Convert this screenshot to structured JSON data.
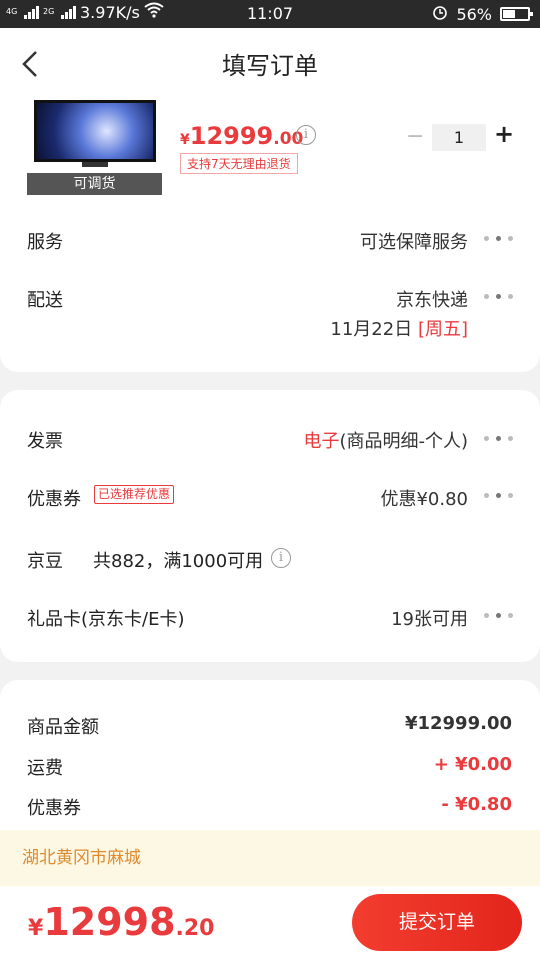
{
  "status_bar": {
    "network": "3.97K/s",
    "time": "11:07",
    "battery": "56%",
    "net_types": [
      "4G",
      "2G"
    ]
  },
  "header": {
    "title": "填写订单"
  },
  "product": {
    "stock_tag": "可调货",
    "price_symbol": "¥",
    "price_int": "12999",
    "price_dec": ".00",
    "return_policy": "支持7天无理由退货",
    "quantity": "1",
    "minus": "−",
    "plus": "+"
  },
  "service": {
    "label": "服务",
    "value": "可选保障服务"
  },
  "delivery": {
    "label": "配送",
    "carrier": "京东快递",
    "date": "11月22日",
    "weekday": "[周五]"
  },
  "invoice": {
    "label": "发票",
    "type": "电子",
    "detail": "(商品明细-个人)"
  },
  "coupon": {
    "label": "优惠券",
    "tag": "已选推荐优惠",
    "value": "优惠¥0.80"
  },
  "jingdou": {
    "label": "京豆",
    "value": "共882，满1000可用"
  },
  "giftcard": {
    "label": "礼品卡(京东卡/E卡)",
    "value": "19张可用"
  },
  "summary": [
    {
      "label": "商品金额",
      "value": "¥12999.00"
    },
    {
      "label": "运费",
      "value": "+ ¥0.00"
    },
    {
      "label": "优惠券",
      "value": "- ¥0.80"
    }
  ],
  "address": "湖北黄冈市麻城",
  "footer": {
    "total_symbol": "¥",
    "total_int": "12998",
    "total_dec": ".20",
    "submit_label": "提交订单"
  },
  "colors": {
    "accent": "#e93b3d",
    "address_text": "#e08a2e",
    "address_bg": "#fdf8e4"
  }
}
